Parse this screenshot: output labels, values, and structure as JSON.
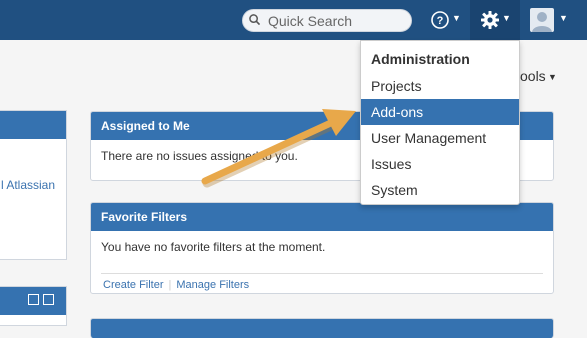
{
  "header": {
    "search_placeholder": "Quick Search",
    "icons": [
      "search-icon",
      "help-icon",
      "gear-icon",
      "user-avatar-icon",
      "caret-icons"
    ]
  },
  "tools_menu": {
    "label": "ools"
  },
  "left_panels": {
    "link_text": "l Atlassian"
  },
  "panels": {
    "assigned": {
      "title": "Assigned to Me",
      "message": "There are no issues assigned to you."
    },
    "filters": {
      "title": "Favorite Filters",
      "message": "You have no favorite filters at the moment.",
      "links": [
        "Create Filter",
        "Manage Filters"
      ]
    }
  },
  "admin_menu": {
    "title": "Administration",
    "items": [
      "Projects",
      "Add-ons",
      "User Management",
      "Issues",
      "System"
    ],
    "active_index": 1
  },
  "colors": {
    "header_bg": "#205081",
    "panel_head": "#3572b0",
    "annotation_arrow": "#e8a84a"
  }
}
